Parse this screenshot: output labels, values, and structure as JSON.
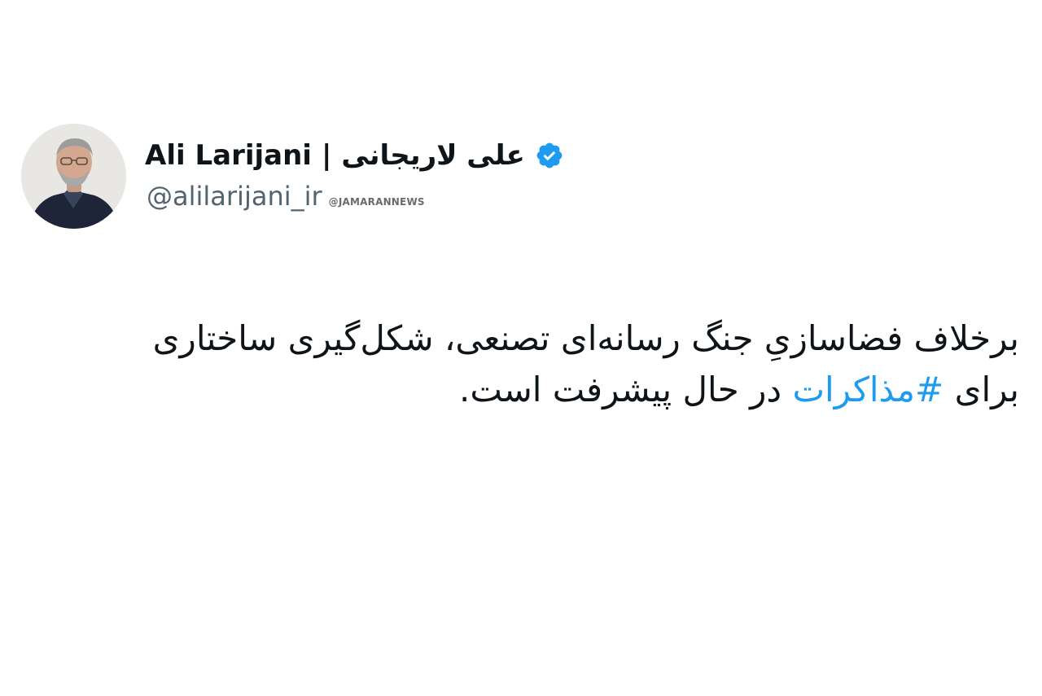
{
  "author": {
    "name_en": "Ali Larijani",
    "separator": "|",
    "name_fa": "علی لاریجانی",
    "handle": "@alilarijani_ir",
    "verified_color": "#1d9bf0",
    "avatar_icon": "profile-photo"
  },
  "watermark": "@JAMARANNEWS",
  "tweet": {
    "line1": "برخلاف فضاسازیِ جنگ رسانه‌ای تصنعی، شکل‌گیری ساختاری",
    "line2_before": "برای",
    "hashtag": "#مذاکرات",
    "line2_after": "در حال پیشرفت است.",
    "hashtag_color": "#1d9bf0"
  }
}
